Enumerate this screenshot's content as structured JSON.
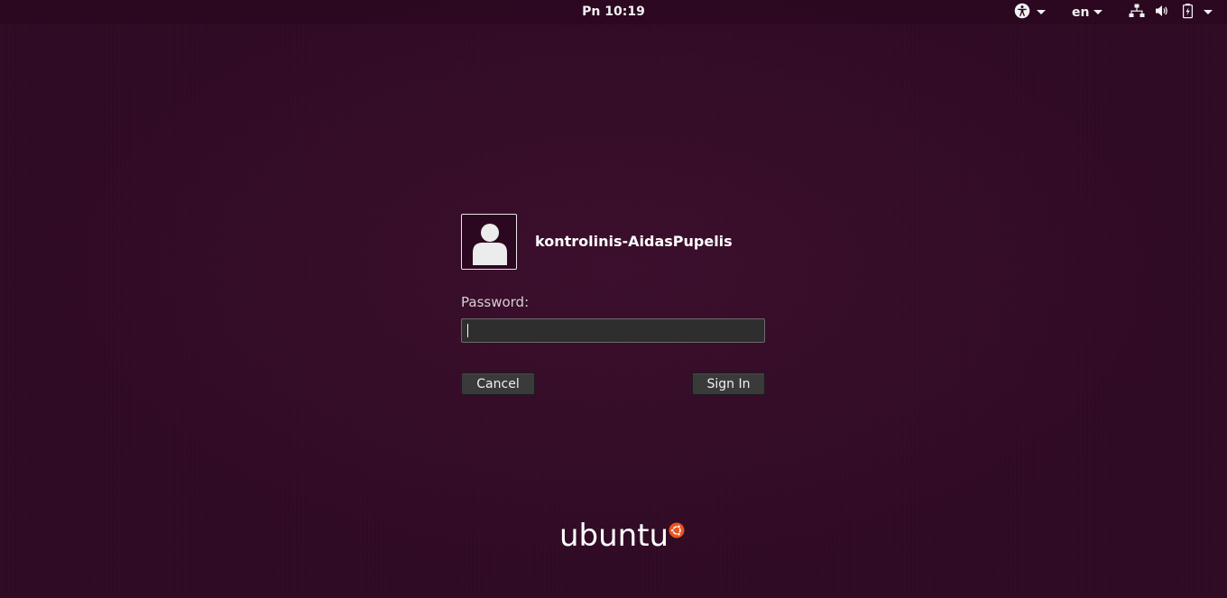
{
  "top_panel": {
    "clock": "Pn 10:19",
    "language": "en",
    "icons": [
      "accessibility-icon",
      "network-icon",
      "volume-icon",
      "battery-icon",
      "system-menu-icon"
    ]
  },
  "login": {
    "username": "kontrolinis-AidasPupelis",
    "password_label": "Password:",
    "password_value": "",
    "cancel_label": "Cancel",
    "signin_label": "Sign In"
  },
  "branding": {
    "logo_text": "ubuntu"
  },
  "colors": {
    "background": "#2f0a24",
    "text": "#ffffff",
    "input_bg": "#2e2e2e",
    "button_bg": "#3a3a3a"
  }
}
